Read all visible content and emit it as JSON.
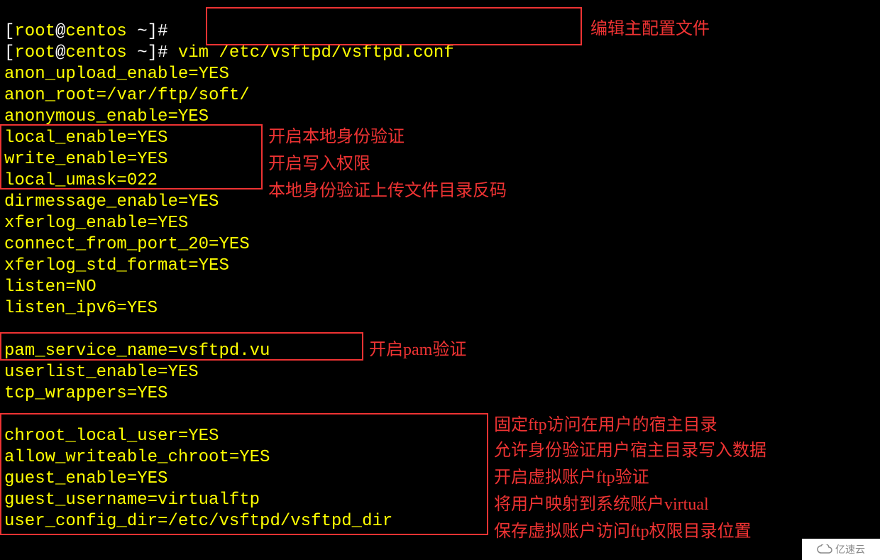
{
  "prompts": {
    "line1_user": "root",
    "line1_host": "centos",
    "line1_path": "~",
    "line1_symbol": "#",
    "line2_user": "root",
    "line2_host": "centos",
    "line2_path": "~",
    "line2_symbol": "#",
    "command": "vim /etc/vsftpd/vsftpd.conf"
  },
  "notes": {
    "edit_main": "编辑主配置文件",
    "local_enable": "开启本地身份验证",
    "write_enable": "开启写入权限",
    "local_umask": "本地身份验证上传文件目录反码",
    "pam": "开启pam验证",
    "chroot_local": "固定ftp访问在用户的宿主目录",
    "allow_writeable": "允许身份验证用户宿主目录写入数据",
    "guest_enable": "开启虚拟账户ftp验证",
    "guest_username": "将用户映射到系统账户virtual",
    "user_config_dir": "保存虚拟账户访问ftp权限目录位置"
  },
  "config": {
    "anon_upload_enable": "anon_upload_enable=YES",
    "anon_root": "anon_root=/var/ftp/soft/",
    "anonymous_enable": "anonymous_enable=YES",
    "local_enable": "local_enable=YES",
    "write_enable": "write_enable=YES",
    "local_umask": "local_umask=022",
    "dirmessage_enable": "dirmessage_enable=YES",
    "xferlog_enable": "xferlog_enable=YES",
    "connect_from_port_20": "connect_from_port_20=YES",
    "xferlog_std_format": "xferlog_std_format=YES",
    "listen": "listen=NO",
    "listen_ipv6": "listen_ipv6=YES",
    "pam_service_name": "pam_service_name=vsftpd.vu",
    "userlist_enable": "userlist_enable=YES",
    "tcp_wrappers": "tcp_wrappers=YES",
    "chroot_local_user": "chroot_local_user=YES",
    "allow_writeable_chroot": "allow_writeable_chroot=YES",
    "guest_enable": "guest_enable=YES",
    "guest_username": "guest_username=virtualftp",
    "user_config_dir": "user_config_dir=/etc/vsftpd/vsftpd_dir"
  },
  "logo_text": "亿速云"
}
